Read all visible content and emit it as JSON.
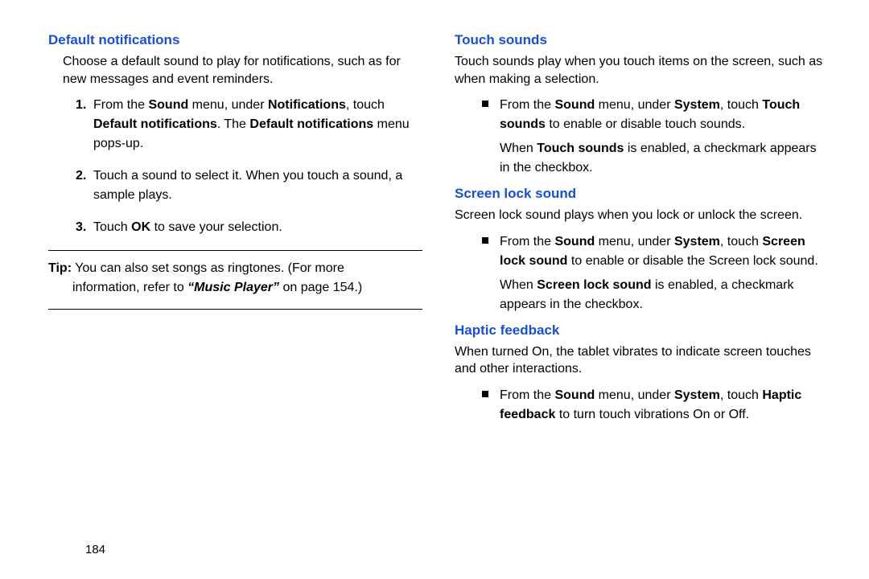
{
  "left": {
    "heading": "Default notifications",
    "intro": "Choose a default sound to play for notifications, such as for new messages and event reminders.",
    "step1_a": "From the ",
    "step1_b": "Sound",
    "step1_c": " menu, under ",
    "step1_d": "Notifications",
    "step1_e": ", touch ",
    "step1_f": "Default notifications",
    "step1_g": ". The ",
    "step1_h": "Default notifications",
    "step1_i": " menu pops-up.",
    "step2": "Touch a sound to select it. When you touch a sound, a sample plays.",
    "step3_a": "Touch ",
    "step3_b": "OK",
    "step3_c": " to save your selection.",
    "tip_label": "Tip:",
    "tip_text": " You can also set songs as ringtones. (For more",
    "tip_cont_a": "information, refer to ",
    "tip_cont_b": "“Music Player”",
    "tip_cont_c": " on page 154.)"
  },
  "right": {
    "h1": "Touch sounds",
    "p1": "Touch sounds play when you touch items on the screen, such as when making a selection.",
    "b1_a": "From the ",
    "b1_b": "Sound",
    "b1_c": " menu, under ",
    "b1_d": "System",
    "b1_e": ", touch ",
    "b1_f": "Touch sounds",
    "b1_g": " to enable or disable touch sounds.",
    "b1_sub_a": "When ",
    "b1_sub_b": "Touch sounds",
    "b1_sub_c": " is enabled, a checkmark appears in the checkbox.",
    "h2": "Screen lock sound",
    "p2": "Screen lock sound plays when you lock or unlock the screen.",
    "b2_a": "From the ",
    "b2_b": "Sound",
    "b2_c": " menu, under ",
    "b2_d": "System",
    "b2_e": ", touch ",
    "b2_f": "Screen lock sound",
    "b2_g": " to enable or disable the Screen lock sound.",
    "b2_sub_a": "When ",
    "b2_sub_b": "Screen lock sound",
    "b2_sub_c": " is enabled, a checkmark appears in the checkbox.",
    "h3": "Haptic feedback",
    "p3": "When turned On, the tablet vibrates to indicate screen touches and other interactions.",
    "b3_a": "From the ",
    "b3_b": "Sound",
    "b3_c": " menu, under ",
    "b3_d": "System",
    "b3_e": ", touch ",
    "b3_f": "Haptic feedback",
    "b3_g": " to turn touch vibrations On or Off."
  },
  "page_number": "184"
}
